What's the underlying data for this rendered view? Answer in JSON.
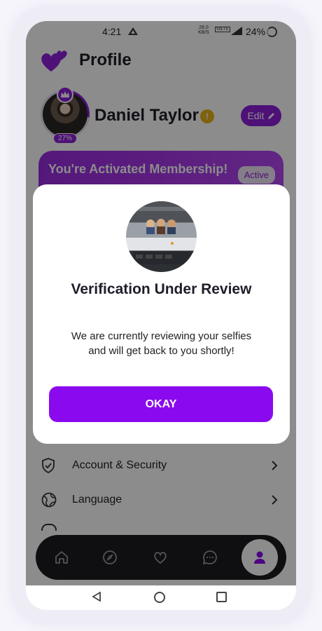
{
  "status_bar": {
    "time": "4:21",
    "net_speed_value": "28.0",
    "net_speed_unit": "KB/S",
    "volte": "VoLTE",
    "battery": "24%"
  },
  "header": {
    "title": "Profile"
  },
  "profile": {
    "name": "Daniel Taylor",
    "verify_badge": "!",
    "completion": "27%",
    "completion_fraction": 0.27,
    "edit_label": "Edit"
  },
  "membership": {
    "text": "You're Activated Membership!",
    "status": "Active"
  },
  "settings": {
    "items": [
      {
        "label": "Account & Security",
        "icon": "shield-check-icon"
      },
      {
        "label": "Language",
        "icon": "globe-icon"
      }
    ]
  },
  "bottom_nav": {
    "items": [
      "home-icon",
      "compass-icon",
      "heart-icon",
      "chat-icon",
      "profile-icon"
    ],
    "active": "profile-icon"
  },
  "dialog": {
    "title": "Verification Under Review",
    "message": "We are currently reviewing your selfies and will get back to you shortly!",
    "button_label": "OKAY"
  },
  "colors": {
    "accent": "#8b09ee",
    "nav_bg": "#1c1c20",
    "verify_badge": "#e8b21a"
  }
}
